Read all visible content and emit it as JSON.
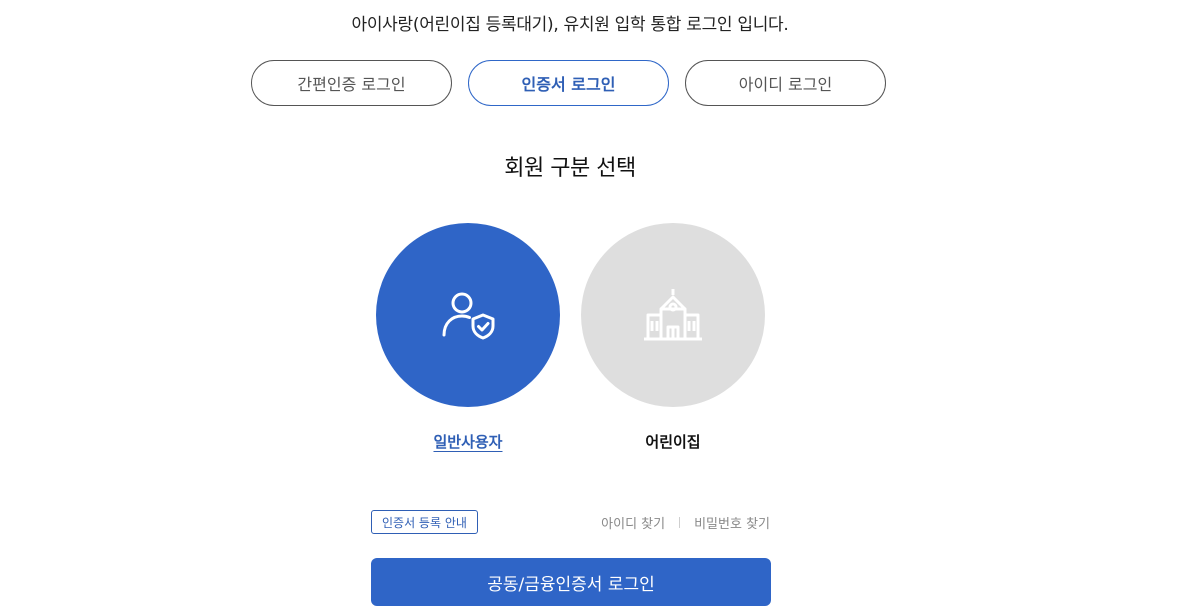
{
  "intro_text": "아이사랑(어린이집 등록대기), 유치원 입학 통합 로그인 입니다.",
  "tabs": [
    {
      "label": "간편인증 로그인",
      "active": false
    },
    {
      "label": "인증서 로그인",
      "active": true
    },
    {
      "label": "아이디 로그인",
      "active": false
    }
  ],
  "section_title": "회원 구분 선택",
  "members": {
    "user": {
      "label": "일반사용자",
      "icon": "user-shield-icon",
      "selected": true,
      "color": "#2f65c7"
    },
    "daycare": {
      "label": "어린이집",
      "icon": "school-building-icon",
      "selected": false,
      "color": "#dedede"
    }
  },
  "cert_guide_label": "인증서 등록 안내",
  "find_links": {
    "find_id": "아이디 찾기",
    "find_password": "비밀번호 찾기"
  },
  "login_button_label": "공동/금융인증서 로그인",
  "colors": {
    "accent": "#2f65c7",
    "accent_text": "#2f5fb5",
    "inactive_circle": "#dedede"
  }
}
